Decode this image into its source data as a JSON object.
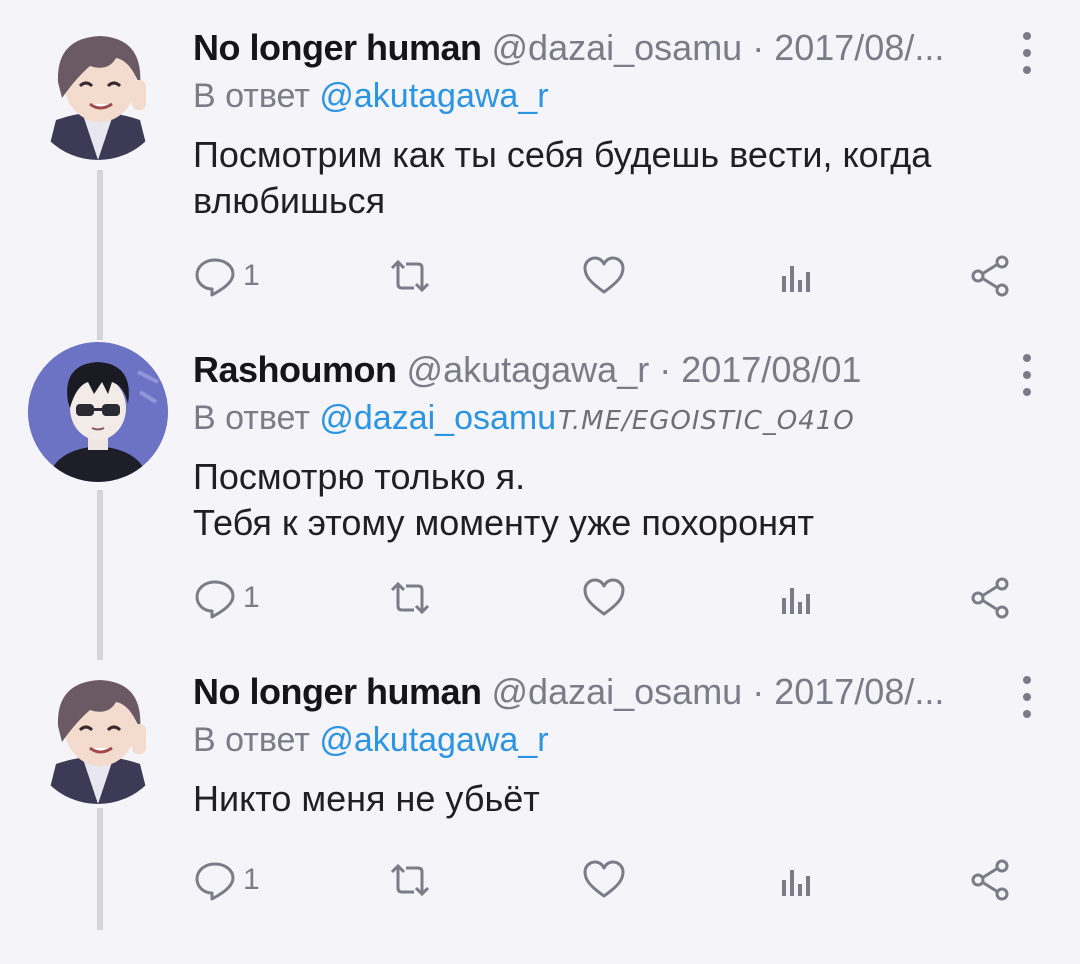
{
  "tweets": [
    {
      "display_name": "No longer human",
      "handle": "@dazai_osamu",
      "date": "· 2017/08/...",
      "reply_prefix": "В ответ",
      "reply_to": "@akutagawa_r",
      "watermark": "",
      "text": "Посмотрим как ты себя будешь вести, когда\nвлюбишься",
      "reply_count": "1",
      "avatar_icon": "avatar-illustration-brown-hair"
    },
    {
      "display_name": "Rashoumon",
      "handle": "@akutagawa_r",
      "date": "· 2017/08/01",
      "reply_prefix": "В ответ",
      "reply_to": "@dazai_osamu",
      "watermark": "T.ME/EGOISTIC_O41O",
      "text": "Посмотрю только я.\nТебя к этому моменту уже похоронят",
      "reply_count": "1",
      "avatar_icon": "avatar-illustration-black-hair-sunglasses"
    },
    {
      "display_name": "No longer human",
      "handle": "@dazai_osamu",
      "date": "· 2017/08/...",
      "reply_prefix": "В ответ",
      "reply_to": "@akutagawa_r",
      "watermark": "",
      "text": "Никто меня не убьёт",
      "reply_count": "1",
      "avatar_icon": "avatar-illustration-brown-hair"
    }
  ],
  "icons": {
    "reply": "reply-icon",
    "retweet": "retweet-icon",
    "like": "heart-icon",
    "stats": "stats-icon",
    "share": "share-icon",
    "more": "more-vertical-icon"
  },
  "colors": {
    "background": "#f5f4f8",
    "text": "#1f1f24",
    "muted": "#7c7c88",
    "mention": "#2b95e3",
    "thread_line": "#d6d5da"
  }
}
